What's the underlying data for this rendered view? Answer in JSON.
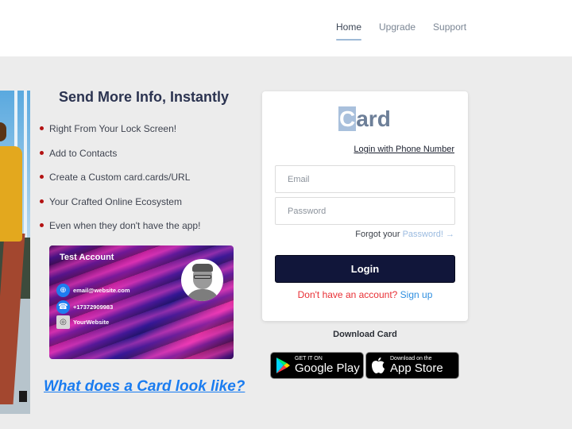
{
  "nav": {
    "items": [
      {
        "label": "Home",
        "active": true
      },
      {
        "label": "Upgrade",
        "active": false
      },
      {
        "label": "Support",
        "active": false
      }
    ]
  },
  "hero": {
    "title": "Send More Info, Instantly",
    "features": [
      "Right From Your Lock Screen!",
      "Add to Contacts",
      "Create a Custom card.cards/URL",
      "Your Crafted Online Ecosystem",
      "Even when they don't have the app!"
    ]
  },
  "demo_card": {
    "name": "Test Account",
    "contacts": [
      {
        "icon": "globe-icon",
        "text": "email@website.com"
      },
      {
        "icon": "phone-icon",
        "text": "+17372909983"
      },
      {
        "icon": "website-icon",
        "text": "YourWebsite"
      }
    ]
  },
  "look_link": "What does a Card look like?",
  "login": {
    "logo_first": "C",
    "logo_rest": "ard",
    "phone_link": "Login with Phone Number",
    "email_placeholder": "Email",
    "password_placeholder": "Password",
    "forgot_prefix": "Forgot your",
    "forgot_link": "Password!",
    "forgot_arrow": "→",
    "login_label": "Login",
    "no_account": "Don't have an account?",
    "signup_label": "Sign up"
  },
  "download": {
    "title": "Download Card",
    "google_small": "GET IT ON",
    "google_big": "Google Play",
    "apple_small": "Download on the",
    "apple_big": "App Store"
  },
  "colors": {
    "accent_dark": "#11163a",
    "link_blue": "#1a7cf0",
    "error_red": "#e82f35",
    "bullet_red": "#b31212"
  }
}
